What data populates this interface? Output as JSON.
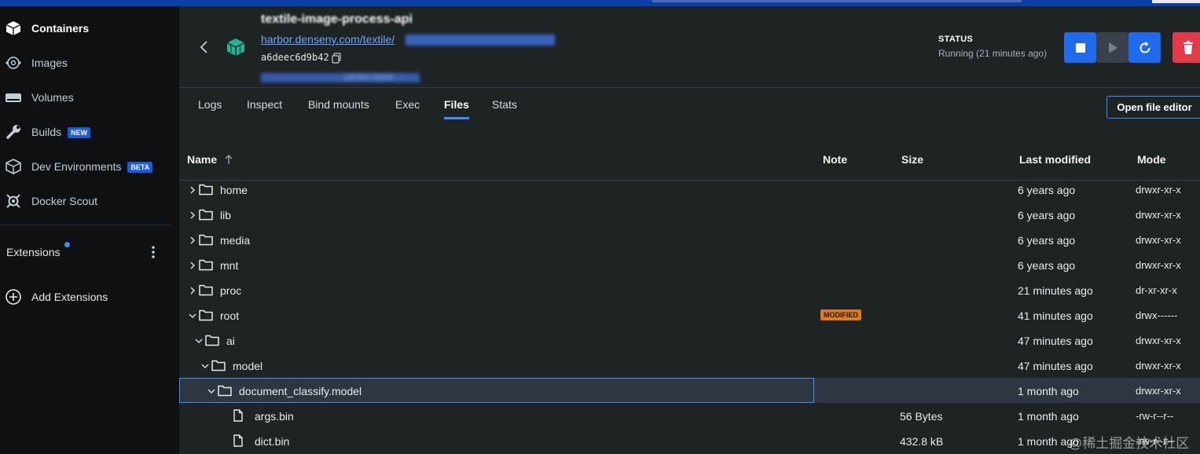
{
  "sidebar": {
    "items": [
      {
        "label": "Containers",
        "icon": "containers-icon",
        "active": true
      },
      {
        "label": "Images",
        "icon": "images-icon"
      },
      {
        "label": "Volumes",
        "icon": "volumes-icon"
      },
      {
        "label": "Builds",
        "icon": "builds-icon",
        "badge": "NEW"
      },
      {
        "label": "Dev Environments",
        "icon": "dev-env-icon",
        "badge": "BETA"
      },
      {
        "label": "Docker Scout",
        "icon": "scout-icon"
      }
    ],
    "extensions_label": "Extensions",
    "add_extensions_label": "Add Extensions"
  },
  "header": {
    "container_name": "textile-image-process-api",
    "image_link": "harbor.denseny.com/textile/",
    "container_id": "a6deec6d9b42",
    "port_text": "18080:5000",
    "status_label": "STATUS",
    "status_value": "Running (21 minutes ago)"
  },
  "tabs": [
    "Logs",
    "Inspect",
    "Bind mounts",
    "Exec",
    "Files",
    "Stats"
  ],
  "active_tab": "Files",
  "open_editor_label": "Open file editor",
  "columns": {
    "name": "Name",
    "note": "Note",
    "size": "Size",
    "modified": "Last modified",
    "mode": "Mode"
  },
  "rows": [
    {
      "name": "home",
      "type": "folder",
      "expanded": false,
      "depth": 0,
      "note": "",
      "size": "",
      "modified": "6 years ago",
      "mode": "drwxr-xr-x"
    },
    {
      "name": "lib",
      "type": "folder",
      "expanded": false,
      "depth": 0,
      "note": "",
      "size": "",
      "modified": "6 years ago",
      "mode": "drwxr-xr-x"
    },
    {
      "name": "media",
      "type": "folder",
      "expanded": false,
      "depth": 0,
      "note": "",
      "size": "",
      "modified": "6 years ago",
      "mode": "drwxr-xr-x"
    },
    {
      "name": "mnt",
      "type": "folder",
      "expanded": false,
      "depth": 0,
      "note": "",
      "size": "",
      "modified": "6 years ago",
      "mode": "drwxr-xr-x"
    },
    {
      "name": "proc",
      "type": "folder",
      "expanded": false,
      "depth": 0,
      "note": "",
      "size": "",
      "modified": "21 minutes ago",
      "mode": "dr-xr-xr-x"
    },
    {
      "name": "root",
      "type": "folder",
      "expanded": true,
      "depth": 0,
      "note": "MODIFIED",
      "size": "",
      "modified": "41 minutes ago",
      "mode": "drwx------"
    },
    {
      "name": "ai",
      "type": "folder",
      "expanded": true,
      "depth": 1,
      "note": "",
      "size": "",
      "modified": "47 minutes ago",
      "mode": "drwxr-xr-x"
    },
    {
      "name": "model",
      "type": "folder",
      "expanded": true,
      "depth": 2,
      "note": "",
      "size": "",
      "modified": "47 minutes ago",
      "mode": "drwxr-xr-x"
    },
    {
      "name": "document_classify.model",
      "type": "folder",
      "expanded": true,
      "depth": 3,
      "note": "",
      "size": "",
      "modified": "1 month ago",
      "mode": "drwxr-xr-x",
      "selected": true
    },
    {
      "name": "args.bin",
      "type": "file",
      "depth": 4,
      "note": "",
      "size": "56 Bytes",
      "modified": "1 month ago",
      "mode": "-rw-r--r--"
    },
    {
      "name": "dict.bin",
      "type": "file",
      "depth": 4,
      "note": "",
      "size": "432.8 kB",
      "modified": "1 month ago",
      "mode": "-rw-r--r--"
    }
  ],
  "watermark": "@稀土掘金技术社区",
  "colors": {
    "accent": "#3f8ef7",
    "stop_button": "#1f6bef",
    "delete_button": "#e2394b",
    "modified_badge": "#e07b1a"
  }
}
